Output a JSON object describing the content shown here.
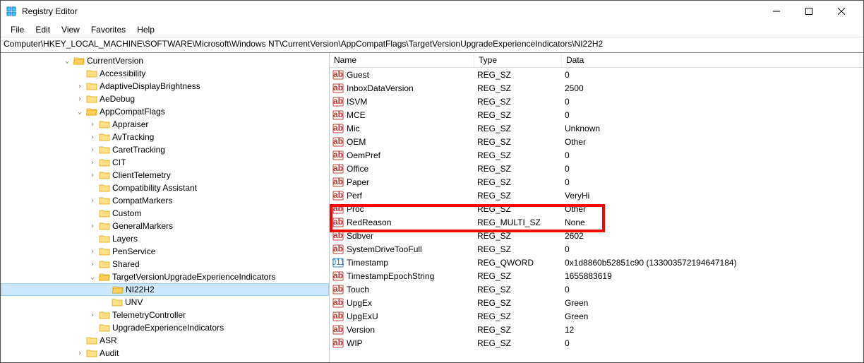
{
  "window": {
    "title": "Registry Editor"
  },
  "menu": {
    "file": "File",
    "edit": "Edit",
    "view": "View",
    "favorites": "Favorites",
    "help": "Help"
  },
  "address": "Computer\\HKEY_LOCAL_MACHINE\\SOFTWARE\\Microsoft\\Windows NT\\CurrentVersion\\AppCompatFlags\\TargetVersionUpgradeExperienceIndicators\\NI22H2",
  "tree": {
    "root": "CurrentVersion",
    "items": [
      {
        "label": "Accessibility",
        "indent": 1,
        "exp": "blank"
      },
      {
        "label": "AdaptiveDisplayBrightness",
        "indent": 1,
        "exp": "closed"
      },
      {
        "label": "AeDebug",
        "indent": 1,
        "exp": "closed"
      },
      {
        "label": "AppCompatFlags",
        "indent": 1,
        "exp": "open"
      },
      {
        "label": "Appraiser",
        "indent": 2,
        "exp": "closed"
      },
      {
        "label": "AvTracking",
        "indent": 2,
        "exp": "closed"
      },
      {
        "label": "CaretTracking",
        "indent": 2,
        "exp": "closed"
      },
      {
        "label": "CIT",
        "indent": 2,
        "exp": "closed"
      },
      {
        "label": "ClientTelemetry",
        "indent": 2,
        "exp": "closed"
      },
      {
        "label": "Compatibility Assistant",
        "indent": 2,
        "exp": "blank"
      },
      {
        "label": "CompatMarkers",
        "indent": 2,
        "exp": "closed"
      },
      {
        "label": "Custom",
        "indent": 2,
        "exp": "blank"
      },
      {
        "label": "GeneralMarkers",
        "indent": 2,
        "exp": "closed"
      },
      {
        "label": "Layers",
        "indent": 2,
        "exp": "blank"
      },
      {
        "label": "PenService",
        "indent": 2,
        "exp": "closed"
      },
      {
        "label": "Shared",
        "indent": 2,
        "exp": "closed"
      },
      {
        "label": "TargetVersionUpgradeExperienceIndicators",
        "indent": 2,
        "exp": "open"
      },
      {
        "label": "NI22H2",
        "indent": 3,
        "exp": "blank",
        "selected": true
      },
      {
        "label": "UNV",
        "indent": 3,
        "exp": "blank"
      },
      {
        "label": "TelemetryController",
        "indent": 2,
        "exp": "closed"
      },
      {
        "label": "UpgradeExperienceIndicators",
        "indent": 2,
        "exp": "blank"
      },
      {
        "label": "ASR",
        "indent": 1,
        "exp": "blank"
      },
      {
        "label": "Audit",
        "indent": 1,
        "exp": "closed"
      }
    ]
  },
  "list": {
    "headers": {
      "name": "Name",
      "type": "Type",
      "data": "Data"
    },
    "rows": [
      {
        "name": "Guest",
        "type": "REG_SZ",
        "data": "0"
      },
      {
        "name": "InboxDataVersion",
        "type": "REG_SZ",
        "data": "2500"
      },
      {
        "name": "ISVM",
        "type": "REG_SZ",
        "data": "0"
      },
      {
        "name": "MCE",
        "type": "REG_SZ",
        "data": "0"
      },
      {
        "name": "Mic",
        "type": "REG_SZ",
        "data": "Unknown"
      },
      {
        "name": "OEM",
        "type": "REG_SZ",
        "data": "Other"
      },
      {
        "name": "OemPref",
        "type": "REG_SZ",
        "data": "0"
      },
      {
        "name": "Office",
        "type": "REG_SZ",
        "data": "0"
      },
      {
        "name": "Paper",
        "type": "REG_SZ",
        "data": "0"
      },
      {
        "name": "Perf",
        "type": "REG_SZ",
        "data": "VeryHi"
      },
      {
        "name": "Proc",
        "type": "REG_SZ",
        "data": "Other"
      },
      {
        "name": "RedReason",
        "type": "REG_MULTI_SZ",
        "data": "None",
        "highlight": true
      },
      {
        "name": "Sdbver",
        "type": "REG_SZ",
        "data": "2602"
      },
      {
        "name": "SystemDriveTooFull",
        "type": "REG_SZ",
        "data": "0"
      },
      {
        "name": "Timestamp",
        "type": "REG_QWORD",
        "data": "0x1d8860b52851c90 (133003572194647184)",
        "binary": true
      },
      {
        "name": "TimestampEpochString",
        "type": "REG_SZ",
        "data": "1655883619"
      },
      {
        "name": "Touch",
        "type": "REG_SZ",
        "data": "0"
      },
      {
        "name": "UpgEx",
        "type": "REG_SZ",
        "data": "Green"
      },
      {
        "name": "UpgExU",
        "type": "REG_SZ",
        "data": "Green"
      },
      {
        "name": "Version",
        "type": "REG_SZ",
        "data": "12"
      },
      {
        "name": "WIP",
        "type": "REG_SZ",
        "data": "0"
      }
    ]
  }
}
